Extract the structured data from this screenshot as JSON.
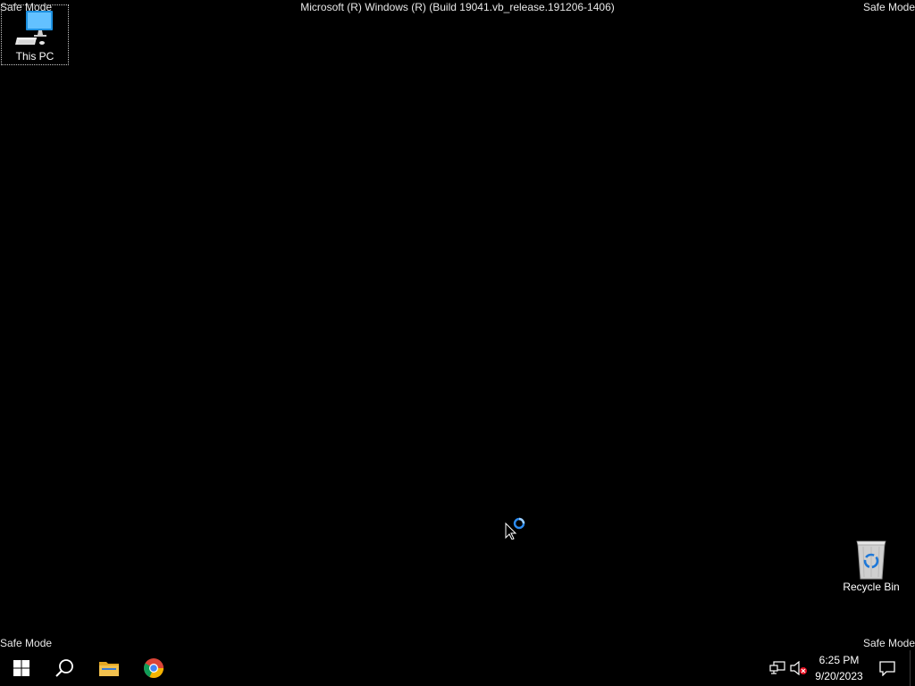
{
  "overlay": {
    "safe_mode_top_left": "Safe Mode",
    "safe_mode_top_right": "Safe Mode",
    "safe_mode_bottom_left": "Safe Mode",
    "safe_mode_bottom_right": "Safe Mode",
    "build_string": "Microsoft (R) Windows (R) (Build 19041.vb_release.191206-1406)"
  },
  "desktop": {
    "background_color": "#000000",
    "icons": [
      {
        "label": "This PC",
        "icon": "computer-icon",
        "selected": true
      },
      {
        "label": "Recycle Bin",
        "icon": "recycle-bin-icon",
        "selected": false
      }
    ]
  },
  "cursor": {
    "state": "busy",
    "icons": [
      "arrow-cursor-icon",
      "busy-spinner-icon"
    ]
  },
  "taskbar": {
    "buttons": [
      {
        "name": "Start",
        "icon": "windows-logo-icon"
      },
      {
        "name": "Search",
        "icon": "search-icon"
      },
      {
        "name": "File Explorer",
        "icon": "folder-icon"
      },
      {
        "name": "Google Chrome",
        "icon": "chrome-icon"
      }
    ],
    "tray": {
      "icons": [
        "network-icon",
        "volume-muted-icon"
      ],
      "time": "6:25 PM",
      "date": "9/20/2023",
      "notification_icon": "action-center-icon"
    }
  },
  "colors": {
    "accent": "#1e90ff",
    "text": "#ffffff",
    "folder": "#f2c14e",
    "mute_badge": "#e81123"
  }
}
